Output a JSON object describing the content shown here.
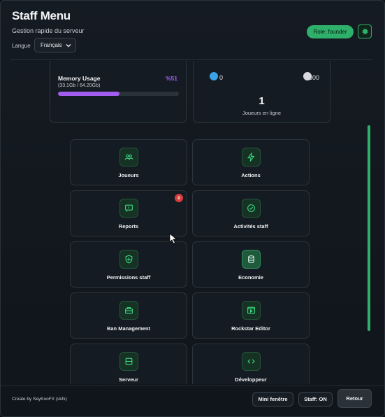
{
  "header": {
    "title": "Staff Menu",
    "subtitle": "Gestion rapide du serveur",
    "language_label": "Langue",
    "language_value": "Français",
    "role_badge": "Role: founder"
  },
  "stats": {
    "memory": {
      "title": "Memory Usage",
      "percent_label": "%51",
      "percent": 51,
      "detail": "(33.1Gb / 64.20Gb)",
      "color": "#a35cf0"
    },
    "players": {
      "slider_min": "0",
      "slider_max": "300",
      "count": "1",
      "label": "Joueurs en ligne"
    }
  },
  "tiles": [
    {
      "label": "Joueurs",
      "icon": "users-icon"
    },
    {
      "label": "Actions",
      "icon": "bolt-icon"
    },
    {
      "label": "Reports",
      "icon": "message-flag-icon",
      "badge": "0"
    },
    {
      "label": "Activités staff",
      "icon": "check-circle-icon"
    },
    {
      "label": "Permissions staff",
      "icon": "shield-icon"
    },
    {
      "label": "Economie",
      "icon": "database-icon"
    },
    {
      "label": "Ban Management",
      "icon": "briefcase-icon"
    },
    {
      "label": "Rockstar Editor",
      "icon": "film-icon"
    },
    {
      "label": "Serveur",
      "icon": "server-icon"
    },
    {
      "label": "Développeur",
      "icon": "code-icon"
    }
  ],
  "footer": {
    "credit": "Create by SeyKooFX (skfx)",
    "mini_window": "Mini fenêtre",
    "staff_toggle": "Staff: ON",
    "back": "Retour"
  },
  "colors": {
    "accent": "#2fb06a",
    "memory_bar": "#a35cf0",
    "notification": "#d93c3c",
    "slider_min_knob": "#3aa3e8"
  }
}
